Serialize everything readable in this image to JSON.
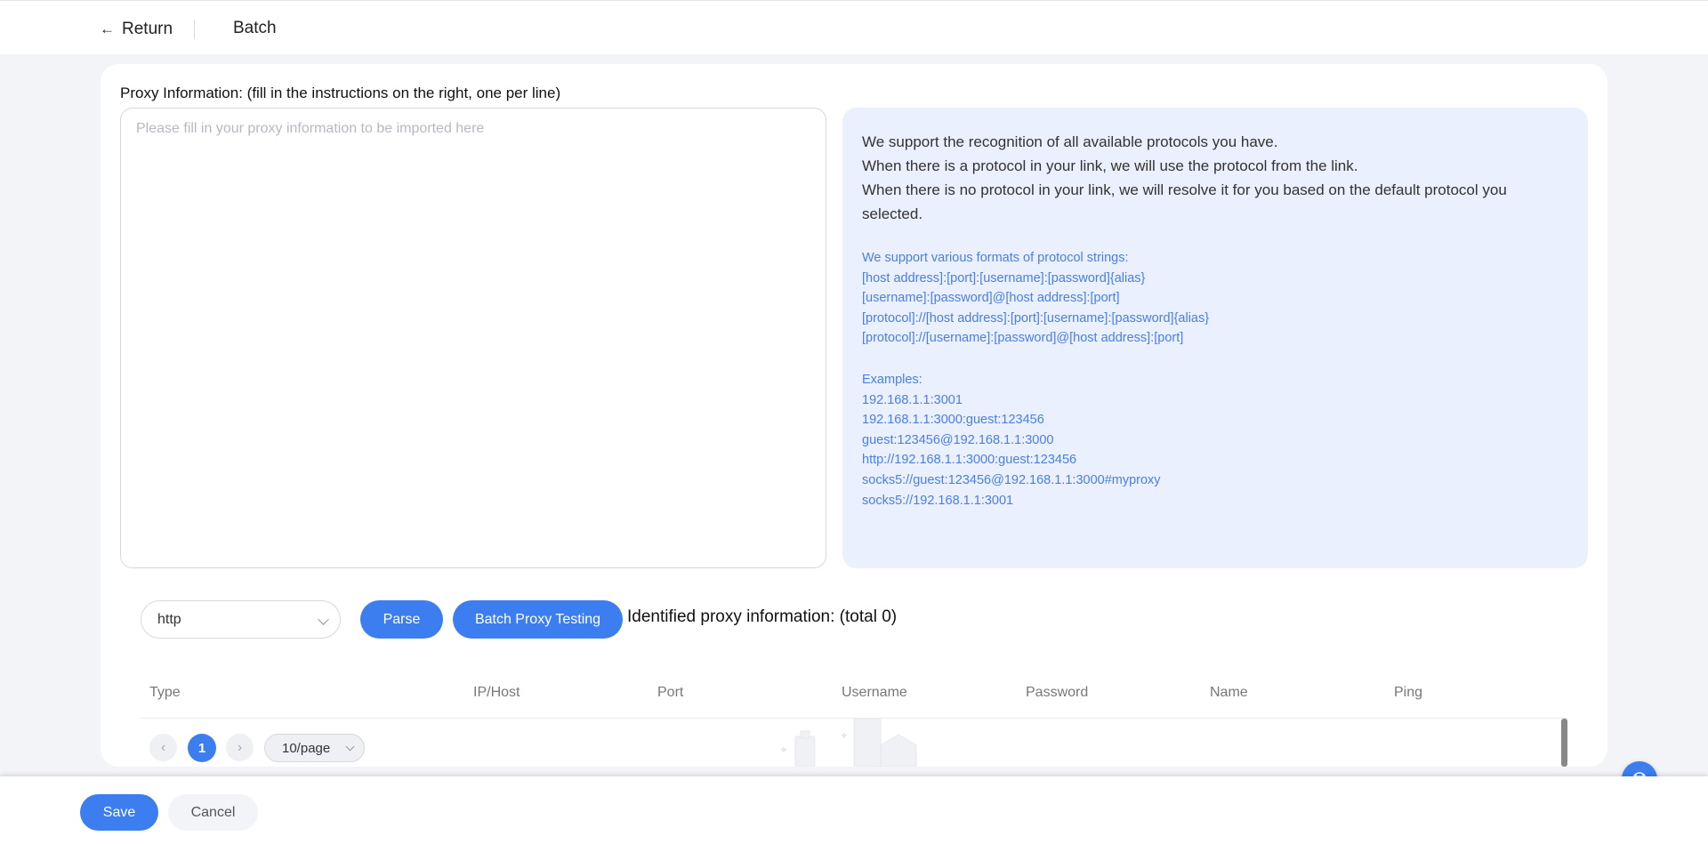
{
  "header": {
    "return_label": "Return",
    "return_icon": "arrow-left-icon",
    "title": "Batch"
  },
  "form": {
    "proxy_label": "Proxy Information: (fill in the instructions on the right, one per line)",
    "proxy_placeholder": "Please fill in your proxy information to be imported here",
    "proxy_value": ""
  },
  "info": {
    "main": [
      "We support the recognition of all available protocols you have.",
      "When there is a protocol in your link, we will use the protocol from the link.",
      "When there is no protocol in your link, we will resolve it for you based on the default protocol you selected."
    ],
    "formats": [
      "We support various formats of protocol strings:",
      "[host address]:[port]:[username]:[password]{alias}",
      "[username]:[password]@[host address]:[port]",
      "[protocol]://[host address]:[port]:[username]:[password]{alias}",
      "[protocol]://[username]:[password]@[host address]:[port]"
    ],
    "examples": [
      "Examples:",
      "192.168.1.1:3001",
      "192.168.1.1:3000:guest:123456",
      "guest:123456@192.168.1.1:3000",
      "http://192.168.1.1:3000:guest:123456",
      "socks5://guest:123456@192.168.1.1:3000#myproxy",
      "socks5://192.168.1.1:3001"
    ]
  },
  "controls": {
    "protocol_selected": "http",
    "parse_label": "Parse",
    "batch_test_label": "Batch Proxy Testing",
    "identified_text": "Identified proxy information: (total 0)"
  },
  "table": {
    "columns": [
      "Type",
      "IP/Host",
      "Port",
      "Username",
      "Password",
      "Name",
      "Ping"
    ]
  },
  "pagination": {
    "current_page": "1",
    "page_size": "10/page",
    "prev_icon": "chevron-left-icon",
    "next_icon": "chevron-right-icon"
  },
  "footer": {
    "save_label": "Save",
    "cancel_label": "Cancel"
  },
  "colors": {
    "primary": "#3c7ef0",
    "info_bg": "#eaf0fd",
    "info_link": "#4a7fe8",
    "page_bg": "#f3f4f7"
  }
}
